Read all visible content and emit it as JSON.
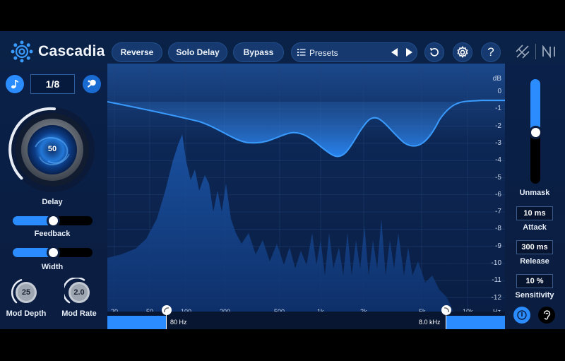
{
  "app": {
    "name": "Cascadia"
  },
  "toolbar": {
    "reverse_label": "Reverse",
    "solo_delay_label": "Solo Delay",
    "bypass_label": "Bypass",
    "presets_label": "Presets"
  },
  "delay": {
    "sync_value": "1/8",
    "knob_value": "50",
    "knob_level": 0.5,
    "label": "Delay"
  },
  "feedback": {
    "label": "Feedback",
    "level": 0.55
  },
  "width": {
    "label": "Width",
    "level": 0.55
  },
  "mod_depth": {
    "label": "Mod Depth",
    "value": "25"
  },
  "mod_rate": {
    "label": "Mod Rate",
    "value": "2.0"
  },
  "unmask": {
    "label": "Unmask",
    "level": 0.55,
    "attack_value": "10 ms",
    "attack_label": "Attack",
    "release_value": "300 ms",
    "release_label": "Release",
    "sensitivity_value": "10 %",
    "sensitivity_label": "Sensitivity"
  },
  "graph": {
    "db_unit": "dB",
    "db_ticks": [
      "0",
      "-1",
      "-2",
      "-3",
      "-4",
      "-5",
      "-6",
      "-7",
      "-8",
      "-9",
      "-10",
      "-11",
      "-12"
    ],
    "freq_ticks": [
      "20",
      "50",
      "100",
      "200",
      "500",
      "1k",
      "2k",
      "5k",
      "10k",
      "Hz"
    ],
    "low_cut_value": "80 Hz",
    "high_cut_value": "8.0 kHz"
  },
  "colors": {
    "accent": "#2a8cff",
    "panel": "#0b1d40",
    "background": "#000000"
  }
}
